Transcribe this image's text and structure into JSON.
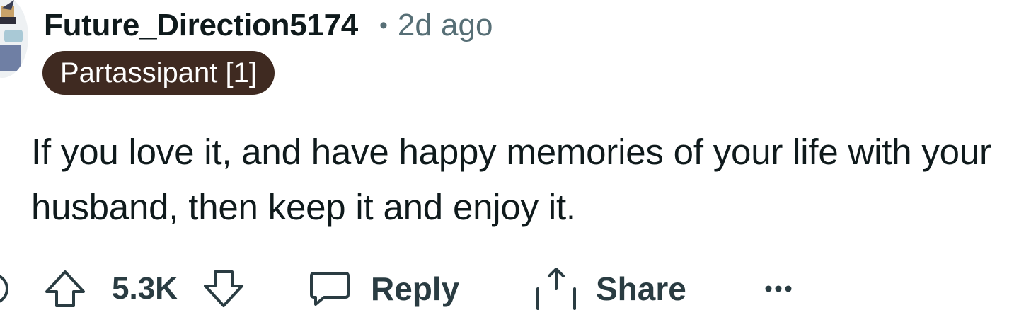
{
  "comment": {
    "author": "Future_Direction5174",
    "separator": "•",
    "timestamp": "2d ago",
    "flair": "Partassipant [1]",
    "body": "If you love it, and have happy memories of your life with your husband, then keep it and enjoy it."
  },
  "actions": {
    "score": "5.3K",
    "reply_label": "Reply",
    "share_label": "Share",
    "more_label": "•••"
  },
  "icons": {
    "avatar": "avatar",
    "collapse": "collapse-icon",
    "upvote": "upvote-arrow-icon",
    "downvote": "downvote-arrow-icon",
    "reply": "speech-bubble-icon",
    "share": "share-icon",
    "more": "more-options-icon"
  },
  "colors": {
    "text_primary": "#0f1a1c",
    "text_secondary": "#576f76",
    "action_text": "#2a3c42",
    "flair_background": "#3f2a21",
    "flair_text": "#ffffff"
  }
}
